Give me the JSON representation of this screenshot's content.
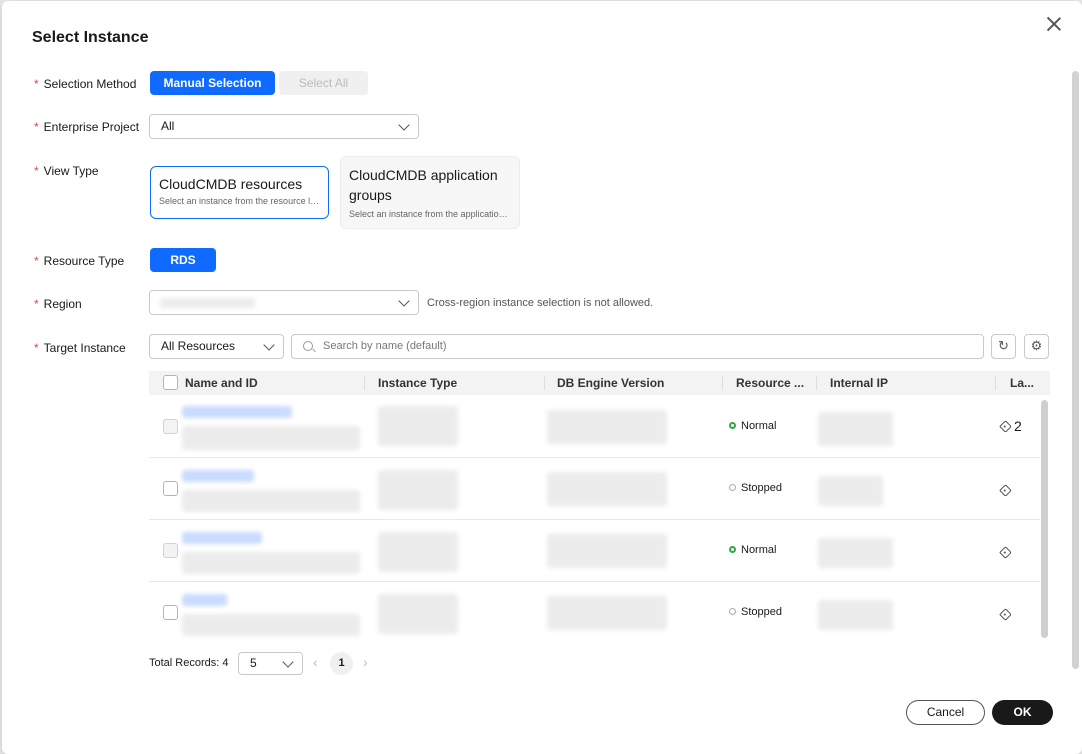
{
  "dialog": {
    "title": "Select Instance",
    "close_label": ""
  },
  "labels": {
    "selection_method": "Selection Method",
    "enterprise_project": "Enterprise Project",
    "view_type": "View Type",
    "resource_type": "Resource Type",
    "region": "Region",
    "target_instance": "Target Instance",
    "required_mark": "*"
  },
  "selection_method": {
    "manual": "Manual Selection",
    "all": "Select All"
  },
  "enterprise_project": {
    "value": "All"
  },
  "view_type": {
    "resources": {
      "title": "CloudCMDB resources",
      "subtitle": "Select an instance from the resource list."
    },
    "groups": {
      "title": "CloudCMDB application groups",
      "subtitle": "Select an instance from the application..."
    }
  },
  "resource_type": {
    "value": "RDS"
  },
  "region": {
    "hint": "Cross-region instance selection is not allowed."
  },
  "target_instance": {
    "filter": "All Resources",
    "search_placeholder": "Search by name (default)"
  },
  "table": {
    "columns": [
      "Name and ID",
      "Instance Type",
      "DB Engine Version",
      "Resource ...",
      "Internal IP",
      "La..."
    ],
    "rows": [
      {
        "status": "Normal",
        "status_color": "#2da844",
        "tag_count": "2"
      },
      {
        "status": "Stopped",
        "status_color": "#aaaaaa",
        "tag_count": ""
      },
      {
        "status": "Normal",
        "status_color": "#2da844",
        "tag_count": ""
      },
      {
        "status": "Stopped",
        "status_color": "#aaaaaa",
        "tag_count": ""
      }
    ]
  },
  "pagination": {
    "total_label": "Total Records: 4",
    "page_size": "5",
    "current_page": "1"
  },
  "footer": {
    "cancel": "Cancel",
    "ok": "OK"
  },
  "colors": {
    "primary": "#0f6bff",
    "required": "#e54545",
    "dark_button": "#191919"
  },
  "icons": [
    "close-icon",
    "chevron-down-icon",
    "search-icon",
    "refresh-icon",
    "settings-icon",
    "tag-icon",
    "chevron-left-icon",
    "chevron-right-icon"
  ]
}
